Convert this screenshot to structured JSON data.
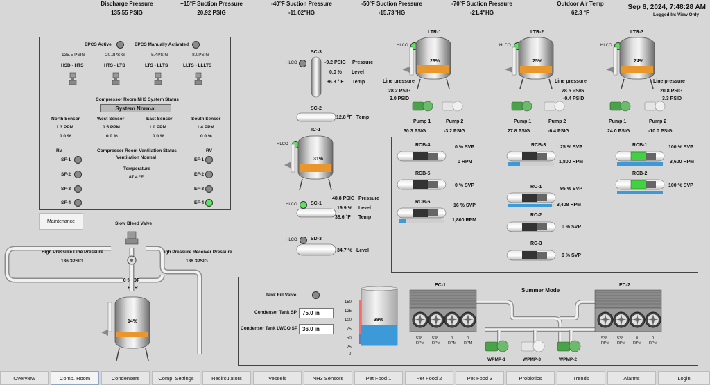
{
  "header": {
    "discharge": {
      "label": "Discharge Pressure",
      "value": "135.55 PSIG"
    },
    "suction15": {
      "label": "+15°F Suction Pressure",
      "value": "20.92 PSIG"
    },
    "suction40": {
      "label": "-40°F Suction Pressure",
      "value": "-11.02\"HG"
    },
    "suction50": {
      "label": "-50°F Suction Pressure",
      "value": "-15.73\"HG"
    },
    "suction70": {
      "label": "-70°F Suction Pressure",
      "value": "-21.4\"HG"
    },
    "outdoor": {
      "label": "Outdoor Air Temp",
      "value": "62.3  °F"
    },
    "datetime": "Sep 6, 2024, 7:48:28 AM",
    "logged_in": "Logged In: View Only"
  },
  "epcs": {
    "active_label": "EPCS Active",
    "manual_label": "EPCS Manually Activated",
    "pressures": [
      "135.5 PSIG",
      "20.9PSIG",
      "-5.4PSIG",
      "-8.0PSIG"
    ],
    "valves": [
      "HSD - HTS",
      "HTS - LTS",
      "LTS - LLTS",
      "LLTS - LLLTS"
    ],
    "nh3_title": "Compressor Room NH3 System Status",
    "nh3_status": "System Normal",
    "sensors": [
      {
        "name": "North Sensor",
        "ppm": "1.3 PPM",
        "pct": "0.0 %"
      },
      {
        "name": "West Sensor",
        "ppm": "0.5 PPM",
        "pct": "0.0 %"
      },
      {
        "name": "East Sensor",
        "ppm": "1.0 PPM",
        "pct": "0.0 %"
      },
      {
        "name": "South Sensor",
        "ppm": "1.4 PPM",
        "pct": "0.0 %"
      }
    ],
    "rv_left": "RV",
    "rv_right": "RV",
    "vent_title": "Compressor Room Ventilation Status",
    "vent_status": "Ventilation Normal",
    "temp_label": "Temperature",
    "temp_value": "87.4 °F",
    "sf": [
      "SF-1",
      "SF-2",
      "SF-3",
      "SF-4"
    ],
    "ef": [
      "EF-1",
      "EF-2",
      "EF-3",
      "EF-4"
    ]
  },
  "maintenance_label": "Maintenance",
  "hpr": {
    "slow_bleed": "Slow Bleed Valve",
    "line_pressure_label": "High Pressure Line Pressure",
    "line_pressure": "136.3PSIG",
    "receiver_pressure_label": "High Pressure Receiver Pressure",
    "receiver_pressure": "136.3PSIG",
    "open_pct": "100 % OPEN",
    "name": "HPR",
    "level": "14%",
    "level_value": 0.14
  },
  "vessels": {
    "sc3": {
      "name": "SC-3",
      "hlco": "HLCO",
      "pressure": "-9.2 PSIG",
      "pressure_label": "Pressure",
      "level": "0.0 %",
      "level_label": "Level",
      "temp": "36.3 ° F",
      "temp_label": "Temp"
    },
    "sc2": {
      "name": "SC-2",
      "temp": "12.8 °F",
      "temp_label": "Temp"
    },
    "ic1": {
      "name": "IC-1",
      "hlco": "HLCO",
      "level": "31%",
      "level_value": 0.31
    },
    "sc1": {
      "name": "SC-1",
      "hlco": "HLCO",
      "pressure": "48.8 PSIG",
      "pressure_label": "Pressure",
      "level": "19.9 %",
      "level_label": "Level",
      "temp": "38.6 °F",
      "temp_label": "Temp"
    },
    "sd3": {
      "name": "SD-3",
      "hlco": "HLCO",
      "level": "34.7 %",
      "level_label": "Level"
    }
  },
  "ltr": [
    {
      "name": "LTR-1",
      "hlco": "HLCO",
      "level": "26%",
      "level_value": 0.26,
      "line_label": "Line pressure",
      "psig": "28.2 PSIG",
      "psid": "2.0 PSID",
      "pump1": "Pump 1",
      "pump2": "Pump 2",
      "p1": "30.3 PSIG",
      "p2": "-3.2 PSIG"
    },
    {
      "name": "LTR-2",
      "hlco": "HLCO",
      "level": "25%",
      "level_value": 0.25,
      "line_label": "Line pressure",
      "psig": "28.5 PSIG",
      "psid": "-0.4 PSID",
      "pump1": "Pump 1",
      "pump2": "Pump 2",
      "p1": "27.8 PSIG",
      "p2": "-6.4 PSIG"
    },
    {
      "name": "LTR-3",
      "hlco": "HLCO",
      "level": "24%",
      "level_value": 0.24,
      "line_label": "Line pressure",
      "psig": "20.8 PSIG",
      "psid": "3.3 PSID",
      "pump1": "Pump 1",
      "pump2": "Pump 2",
      "p1": "24.0 PSIG",
      "p2": "-10.0 PSIG"
    }
  ],
  "compressors": [
    {
      "name": "RCB-4",
      "svp": "0 % SVP",
      "rpm": "0 RPM",
      "running": false,
      "load": 0.0
    },
    {
      "name": "RCB-5",
      "svp": "0 % SVP",
      "rpm": "",
      "running": false,
      "load": 0.0
    },
    {
      "name": "RCB-6",
      "svp": "16 % SVP",
      "rpm": "1,800 RPM",
      "running": false,
      "load": 0.16
    },
    {
      "name": "RCB-3",
      "svp": "25 % SVP",
      "rpm": "1,800 RPM",
      "running": false,
      "load": 0.25
    },
    {
      "name": "RC-1",
      "svp": "95 % SVP",
      "rpm": "3,408 RPM",
      "running": false,
      "load": 0.95
    },
    {
      "name": "RC-2",
      "svp": "0 % SVP",
      "rpm": "",
      "running": false,
      "load": 0.0
    },
    {
      "name": "RC-3",
      "svp": "0 % SVP",
      "rpm": "",
      "running": false,
      "load": 0.0
    },
    {
      "name": "RCB-1",
      "svp": "100 % SVP",
      "rpm": "3,600 RPM",
      "running": true,
      "load": 1.0
    },
    {
      "name": "RCB-2",
      "svp": "100 % SVP",
      "rpm": "",
      "running": true,
      "load": 1.0
    }
  ],
  "condenser": {
    "tank_fill_label": "Tank Fill Valve",
    "tank_sp_label": "Condenser Tank SP",
    "tank_sp": "75.0 in",
    "lwco_label": "Condenser Tank LWCO SP",
    "lwco_sp": "36.0 in",
    "tank_level": "38%",
    "tank_level_value": 0.38,
    "scale": [
      "150",
      "125",
      "100",
      "75",
      "50",
      "25",
      "0"
    ],
    "mode": "Summer Mode",
    "ec1": {
      "name": "EC-1",
      "rpms": [
        "538",
        "538",
        "0",
        "0"
      ]
    },
    "ec2": {
      "name": "EC-2",
      "rpms": [
        "538",
        "538",
        "0",
        "0"
      ]
    },
    "rpm_unit": "RPM",
    "pumps": [
      "WPMP-1",
      "WPMP-3",
      "WPMP-2"
    ]
  },
  "tabs": [
    "Overview",
    "Comp. Room",
    "Condensers",
    "Comp. Settings",
    "Recirculators",
    "Vessels",
    "NH3 Sensors",
    "Pet Food 1",
    "Pet Food 2",
    "Pet Food 3",
    "Probiotics",
    "Trends",
    "Alarms",
    "Login"
  ],
  "colors": {
    "liquid": "#e9962d",
    "water": "#3c9ad8",
    "running": "#43d043",
    "indicator_off": "#8a8a8a",
    "indicator_on": "#5fe35f"
  }
}
